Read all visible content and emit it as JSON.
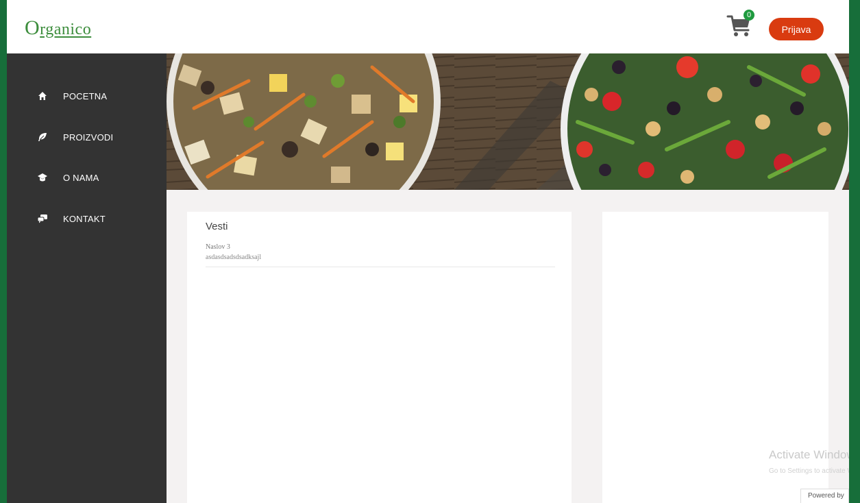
{
  "brand": {
    "logo_initial": "O",
    "logo_rest": "rganico"
  },
  "header": {
    "cart_count": "0",
    "login_label": "Prijava"
  },
  "sidebar": {
    "items": [
      {
        "label": "POCETNA",
        "icon": "home-icon"
      },
      {
        "label": "PROIZVODI",
        "icon": "leaf-icon"
      },
      {
        "label": "O NAMA",
        "icon": "graduation-cap-icon"
      },
      {
        "label": "KONTAKT",
        "icon": "chat-icon"
      }
    ]
  },
  "news": {
    "title": "Vesti",
    "items": [
      {
        "title": "Naslov 3",
        "text": "asdasdsadsdsadksajl"
      }
    ]
  },
  "watermark": {
    "line1": "Activate Windows",
    "line2": "Go to Settings to activate Windows."
  },
  "footer": {
    "powered": "Powered by"
  },
  "colors": {
    "frame": "#176e3a",
    "sidebar": "#333333",
    "accent": "#d93b10",
    "badge": "#1f9a3f"
  }
}
